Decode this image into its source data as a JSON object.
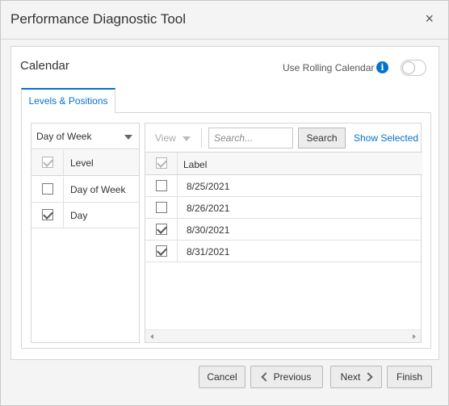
{
  "dialog": {
    "title": "Performance Diagnostic Tool",
    "close_label": "×"
  },
  "calendar": {
    "title": "Calendar",
    "rolling_label": "Use Rolling Calendar",
    "rolling_enabled": false,
    "info_glyph": "i"
  },
  "tabs": [
    {
      "label": "Levels & Positions",
      "active": true
    }
  ],
  "levels": {
    "selected_dimension": "Day of Week",
    "header": "Level",
    "header_checked": true,
    "rows": [
      {
        "label": "Day of Week",
        "checked": false
      },
      {
        "label": "Day",
        "checked": true
      }
    ]
  },
  "positions": {
    "view_label": "View",
    "search_placeholder": "Search...",
    "search_button": "Search",
    "show_selected": "Show Selected",
    "header": "Label",
    "header_checked": true,
    "rows": [
      {
        "label": "8/25/2021",
        "checked": false
      },
      {
        "label": "8/26/2021",
        "checked": false
      },
      {
        "label": "8/30/2021",
        "checked": true
      },
      {
        "label": "8/31/2021",
        "checked": true
      }
    ]
  },
  "footer": {
    "cancel": "Cancel",
    "previous": "Previous",
    "next": "Next",
    "finish": "Finish"
  },
  "colors": {
    "accent": "#0572ce",
    "border": "#d6d6d6",
    "button_bg": "#ececec"
  }
}
